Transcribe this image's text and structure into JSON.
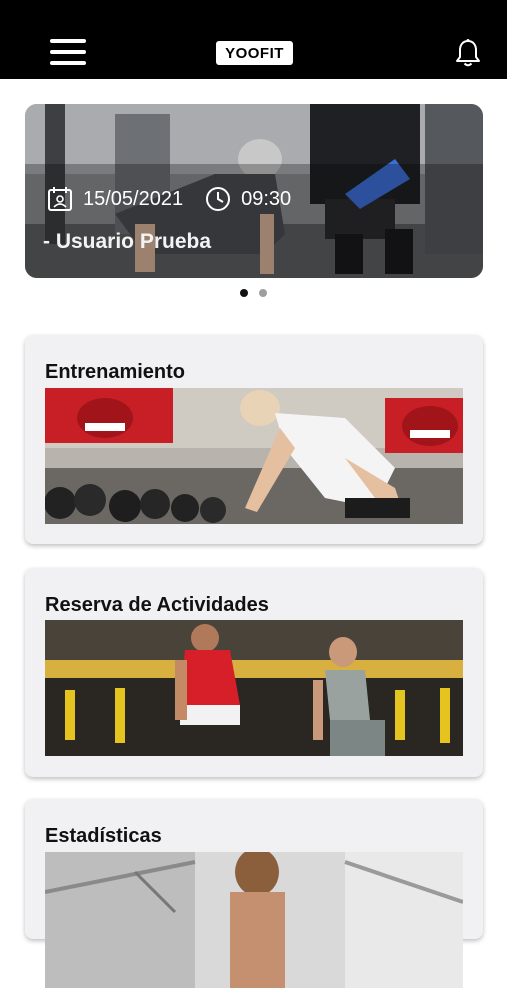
{
  "header": {
    "menu_icon": "hamburger-menu-icon",
    "logo_text": "YOOFIT",
    "notification_icon": "bell-icon"
  },
  "carousel": {
    "date": "15/05/2021",
    "time": "09:30",
    "user": "- Usuario Prueba",
    "slides": 2,
    "active_index": 0
  },
  "cards": [
    {
      "title": "Entrenamiento"
    },
    {
      "title": "Reserva de Actividades"
    },
    {
      "title": "Estadísticas"
    }
  ],
  "colors": {
    "header_bg": "#000000",
    "card_bg": "#f1f1f3",
    "text": "#111111"
  }
}
